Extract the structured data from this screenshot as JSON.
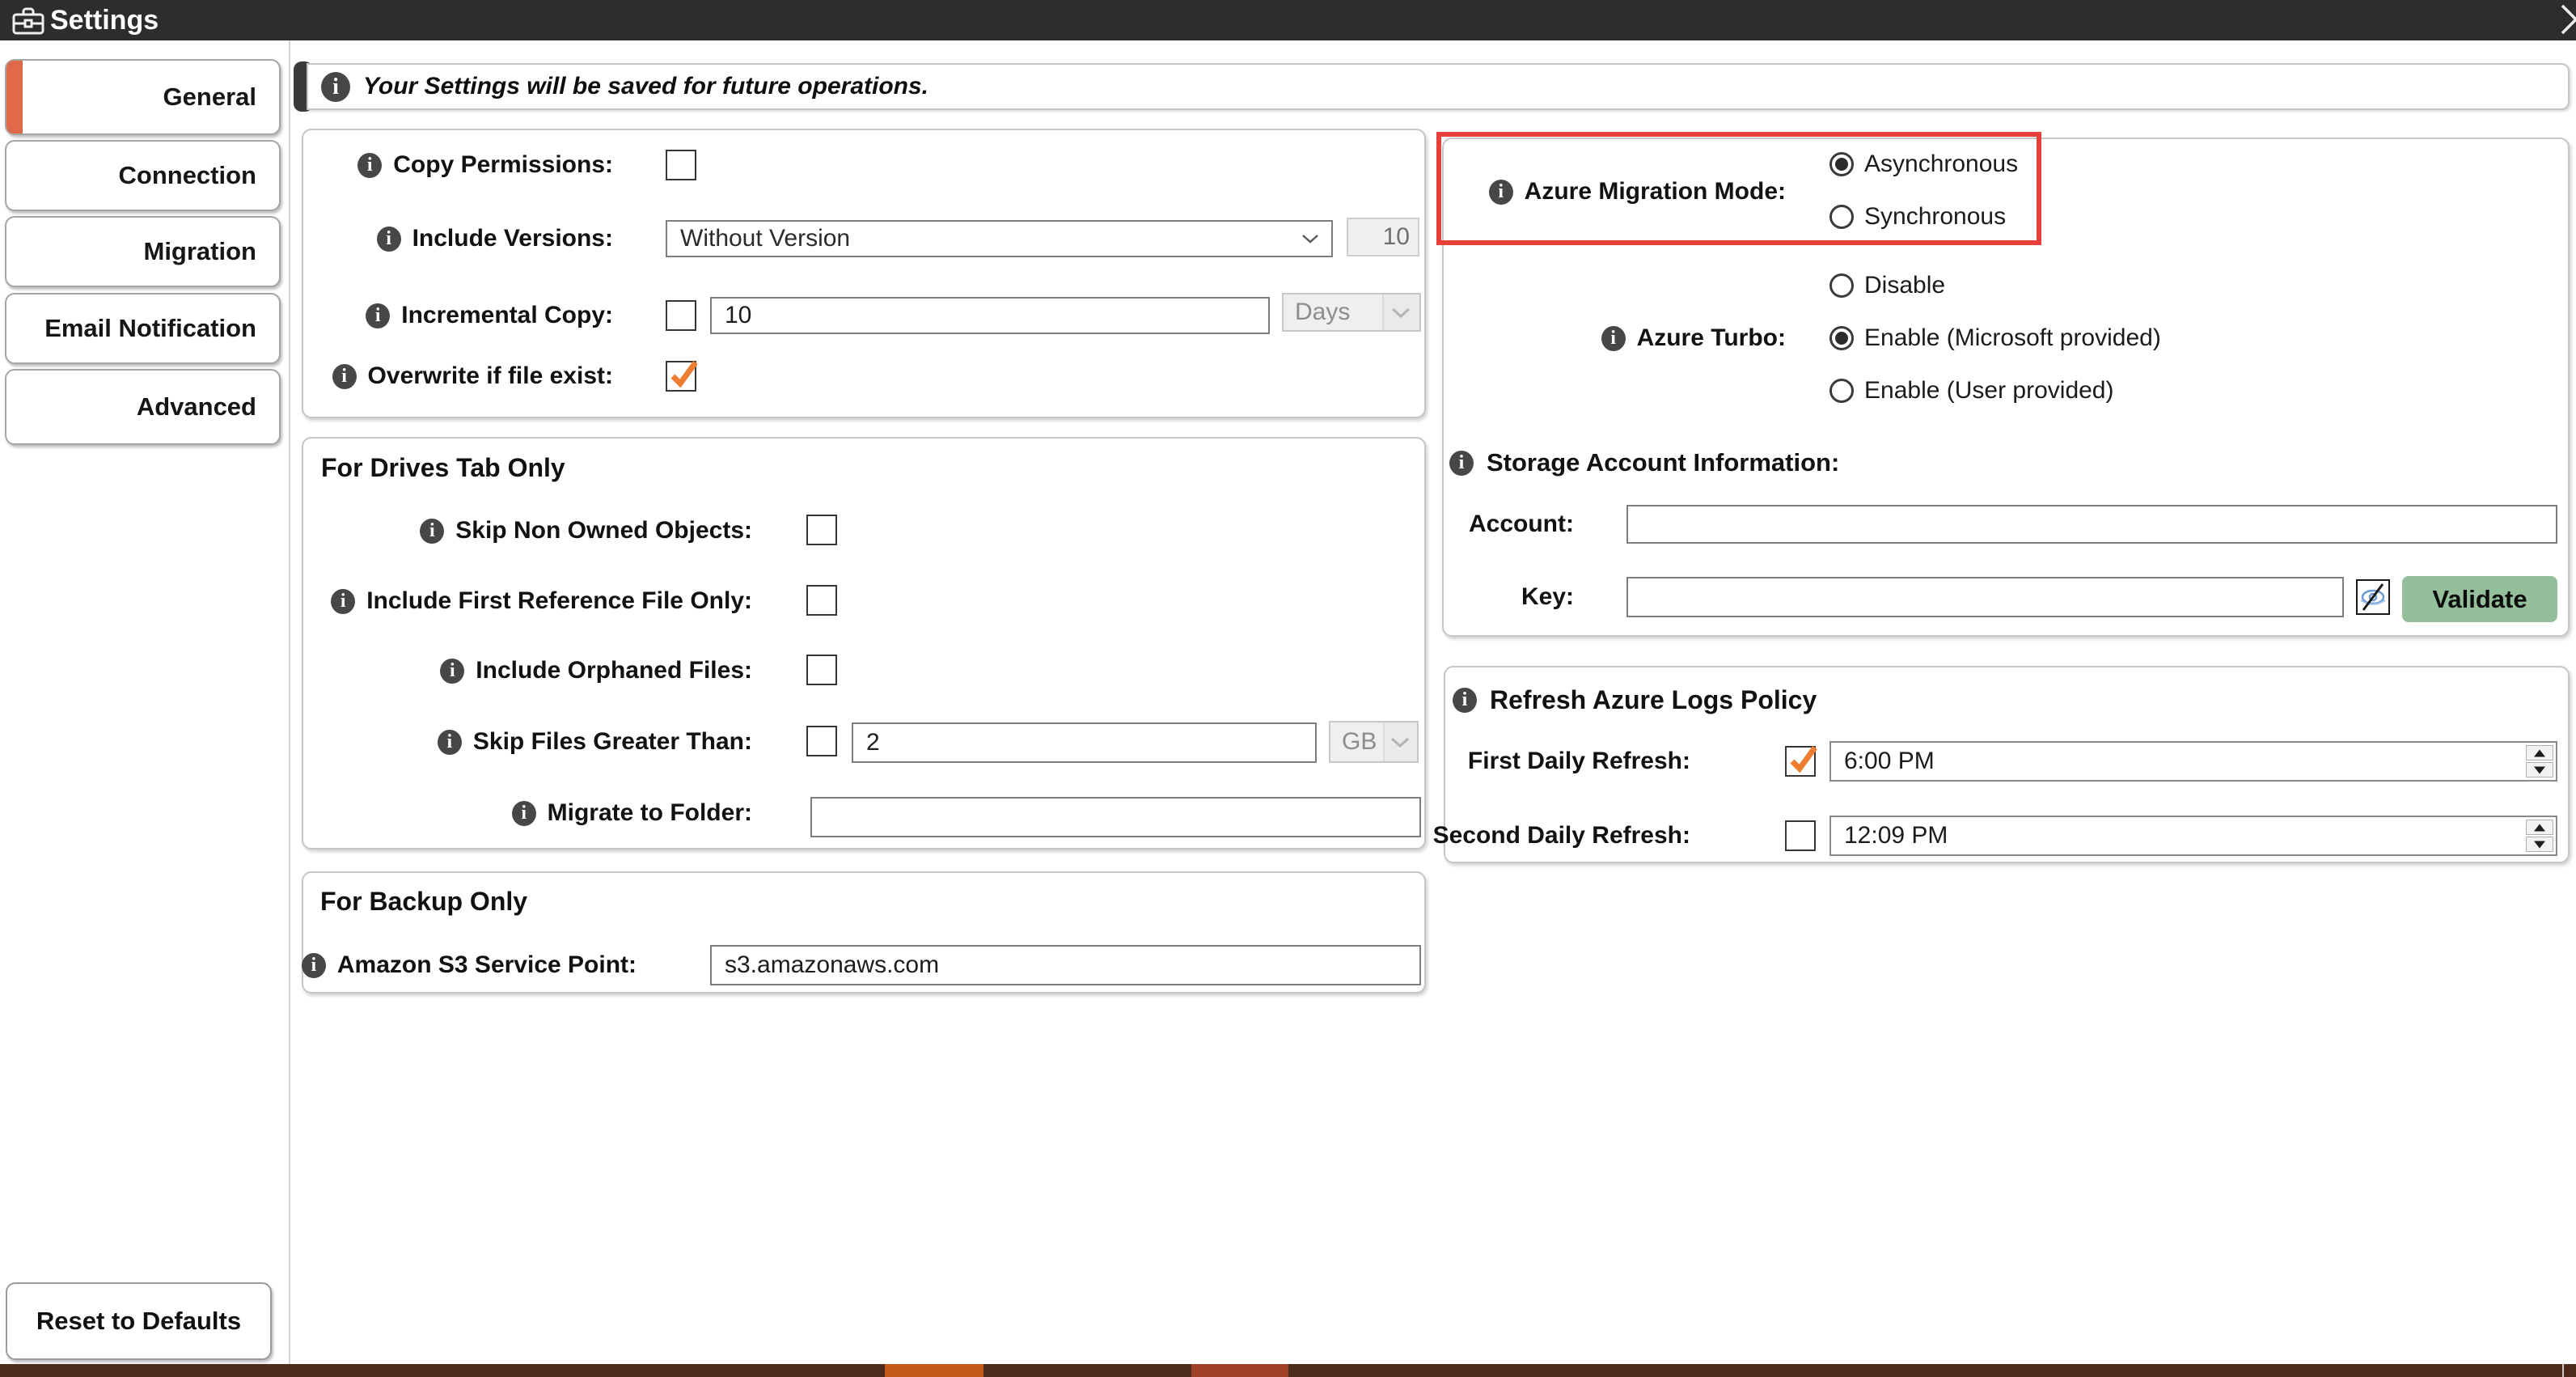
{
  "titlebar": {
    "title": "Settings"
  },
  "sidebar": {
    "tabs": [
      {
        "label": "General",
        "active": true
      },
      {
        "label": "Connection",
        "active": false
      },
      {
        "label": "Migration",
        "active": false
      },
      {
        "label": "Email Notification",
        "active": false
      },
      {
        "label": "Advanced",
        "active": false
      }
    ],
    "reset_label": "Reset to Defaults"
  },
  "banner": {
    "text": "Your Settings will be saved for future operations."
  },
  "colors": {
    "accent_orange": "#e0694a",
    "check_orange": "#ED7D31",
    "validate_green": "#94bf9b",
    "highlight_red": "#e6403a",
    "strip_brown": "#4c2b1c",
    "strip_orange": "#c4591a",
    "strip_brick": "#9e4126"
  },
  "general": {
    "copy_permissions": {
      "label": "Copy Permissions:",
      "checked": false
    },
    "include_versions": {
      "label": "Include Versions:",
      "value": "Without Version",
      "versions_count": "10"
    },
    "incremental_copy": {
      "label": "Incremental Copy:",
      "checked": false,
      "value": "10",
      "unit": "Days"
    },
    "overwrite": {
      "label": "Overwrite if file exist:",
      "checked": true
    }
  },
  "drives": {
    "title": "For Drives Tab Only",
    "skip_non_owned": {
      "label": "Skip Non Owned Objects:",
      "checked": false
    },
    "include_first_ref": {
      "label": "Include First Reference File Only:",
      "checked": false
    },
    "include_orphaned": {
      "label": "Include Orphaned Files:",
      "checked": false
    },
    "skip_files_greater": {
      "label": "Skip Files Greater Than:",
      "checked": false,
      "value": "2",
      "unit": "GB"
    },
    "migrate_to_folder": {
      "label": "Migrate to Folder:",
      "value": ""
    }
  },
  "backup": {
    "title": "For Backup Only",
    "s3": {
      "label": "Amazon S3 Service Point:",
      "value": "s3.amazonaws.com"
    }
  },
  "azure": {
    "migration_mode": {
      "label": "Azure Migration Mode:",
      "options": [
        "Asynchronous",
        "Synchronous"
      ],
      "selected": "Asynchronous"
    },
    "turbo": {
      "label": "Azure Turbo:",
      "options": [
        "Disable",
        "Enable (Microsoft provided)",
        "Enable (User provided)"
      ],
      "selected": "Enable (Microsoft provided)"
    },
    "storage": {
      "title": "Storage Account Information:",
      "account_label": "Account:",
      "account_value": "",
      "key_label": "Key:",
      "key_value": "",
      "validate_label": "Validate"
    },
    "refresh": {
      "title": "Refresh Azure Logs Policy",
      "first": {
        "label": "First Daily Refresh:",
        "checked": true,
        "time": "6:00 PM"
      },
      "second": {
        "label": "Second Daily Refresh:",
        "checked": false,
        "time": "12:09 PM"
      }
    }
  }
}
